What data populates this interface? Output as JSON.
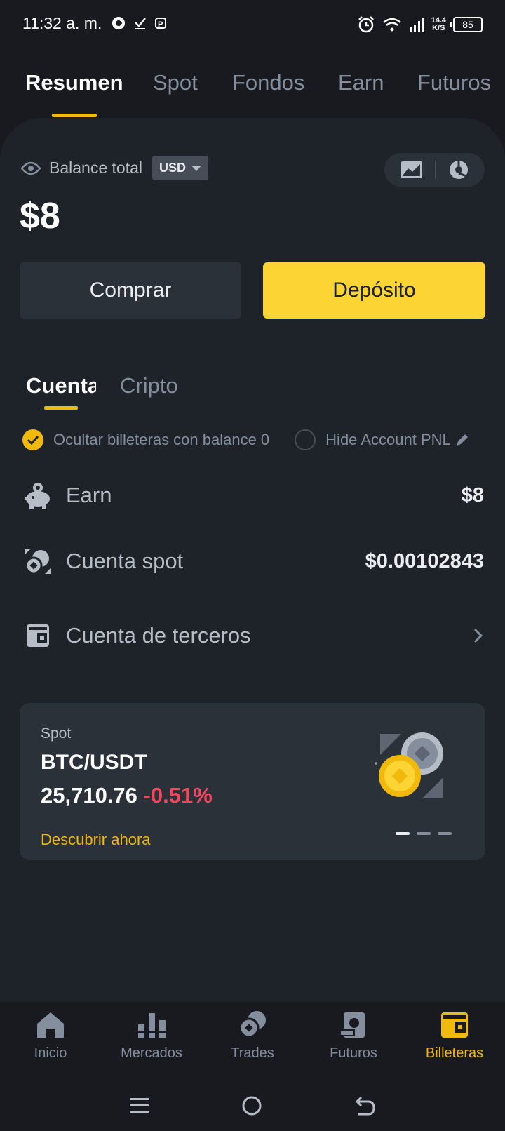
{
  "status_bar": {
    "time": "11:32 a. m.",
    "net_speed_value": "14.4",
    "net_speed_unit": "K/S",
    "battery": "85"
  },
  "top_tabs": [
    "Resumen",
    "Spot",
    "Fondos",
    "Earn",
    "Futuros"
  ],
  "balance": {
    "label": "Balance total",
    "currency": "USD",
    "amount": "$8"
  },
  "actions": {
    "buy": "Comprar",
    "deposit": "Depósito"
  },
  "sub_tabs": [
    "Cuenta",
    "Cripto"
  ],
  "filters": {
    "hide_zero": "Ocultar billeteras con balance 0",
    "hide_pnl": "Hide Account PNL"
  },
  "accounts": [
    {
      "label": "Earn",
      "value": "$8",
      "icon": "piggy-bank-icon"
    },
    {
      "label": "Cuenta spot",
      "value": "$0.00102843",
      "icon": "spot-coins-icon"
    },
    {
      "label": "Cuenta de terceros",
      "value": "",
      "icon": "wallet-icon"
    }
  ],
  "promo": {
    "label": "Spot",
    "pair": "BTC/USDT",
    "price": "25,710.76",
    "change": "-0.51%",
    "link": "Descubrir ahora"
  },
  "bottom_nav": [
    {
      "label": "Inicio",
      "icon": "home-icon"
    },
    {
      "label": "Mercados",
      "icon": "markets-icon"
    },
    {
      "label": "Trades",
      "icon": "trades-icon"
    },
    {
      "label": "Futuros",
      "icon": "futures-icon"
    },
    {
      "label": "Billeteras",
      "icon": "wallet-icon"
    }
  ],
  "colors": {
    "background": "#181a20",
    "card": "#1e2329",
    "accent": "#f0b90b",
    "primary_button": "#fcd535",
    "negative": "#f6465d"
  }
}
